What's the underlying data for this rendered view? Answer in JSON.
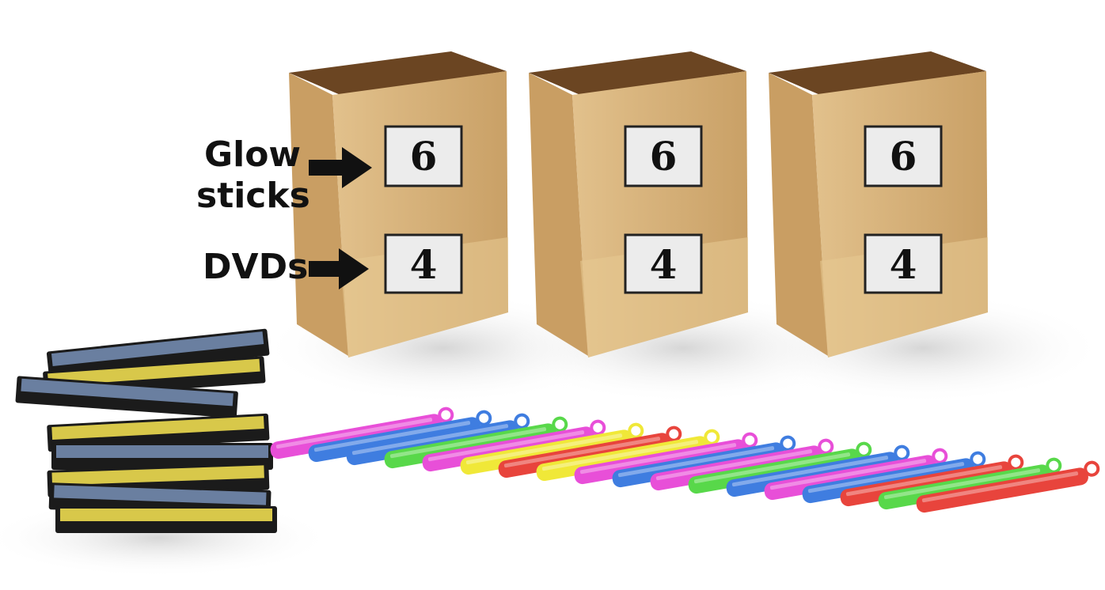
{
  "labels": {
    "glow_line1": "Glow",
    "glow_line2": "sticks",
    "dvds": "DVDs"
  },
  "bags": [
    {
      "glow_sticks": "6",
      "dvds": "4"
    },
    {
      "glow_sticks": "6",
      "dvds": "4"
    },
    {
      "glow_sticks": "6",
      "dvds": "4"
    }
  ],
  "colors": {
    "bag": "#d8b27a",
    "bag_dark": "#b98d52",
    "glow_sticks": [
      "#e84fd8",
      "#3f7de0",
      "#58d84a",
      "#f0e838",
      "#e8443c"
    ]
  }
}
